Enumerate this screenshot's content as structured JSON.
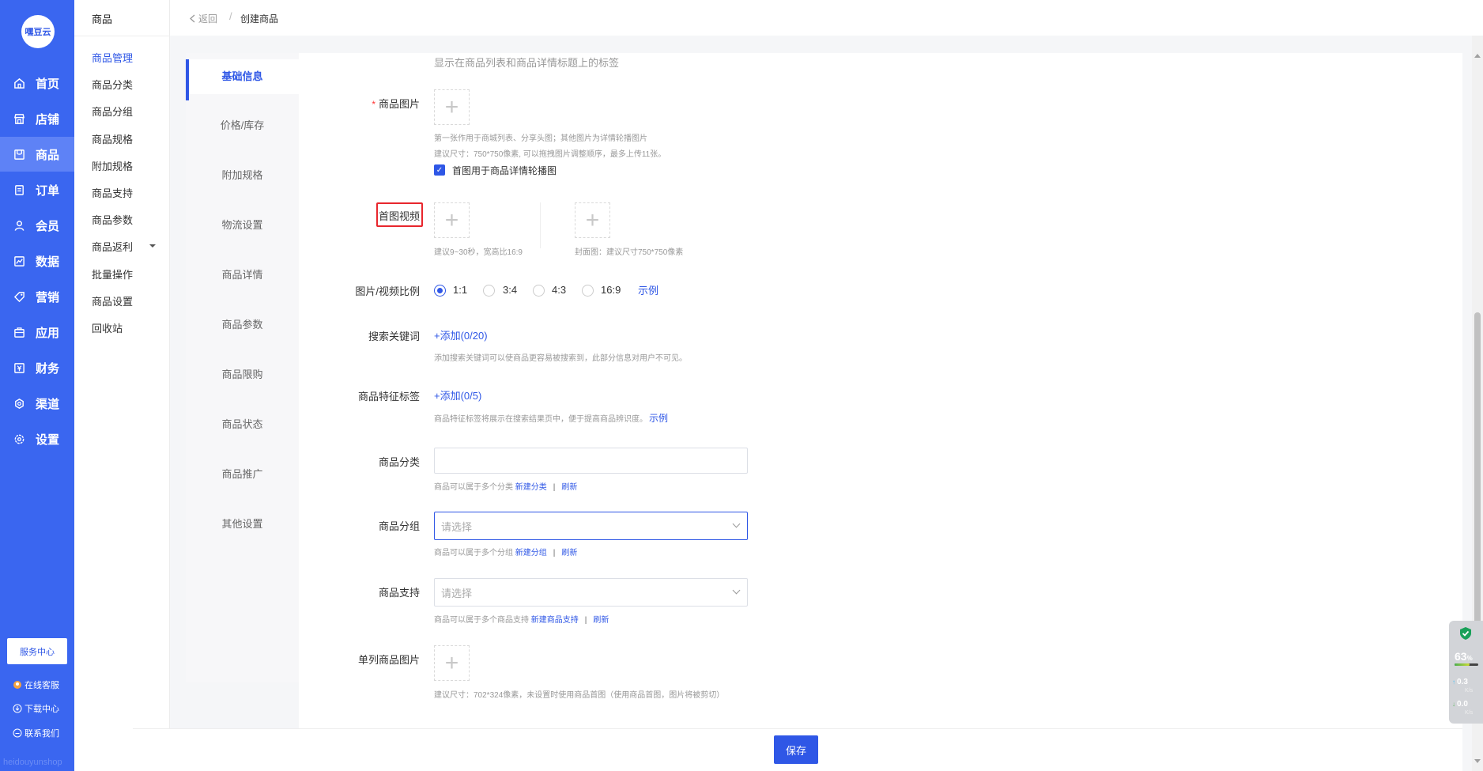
{
  "app": {
    "logo_text": "嘿豆云",
    "watermark": "heidouyunshop"
  },
  "nav": {
    "items": [
      {
        "label": "首页",
        "icon": "home-icon"
      },
      {
        "label": "店铺",
        "icon": "store-icon"
      },
      {
        "label": "商品",
        "icon": "goods-icon",
        "active": true
      },
      {
        "label": "订单",
        "icon": "order-icon"
      },
      {
        "label": "会员",
        "icon": "member-icon"
      },
      {
        "label": "数据",
        "icon": "data-icon"
      },
      {
        "label": "营销",
        "icon": "marketing-icon"
      },
      {
        "label": "应用",
        "icon": "app-icon"
      },
      {
        "label": "财务",
        "icon": "finance-icon"
      },
      {
        "label": "渠道",
        "icon": "channel-icon"
      },
      {
        "label": "设置",
        "icon": "settings-icon"
      }
    ],
    "service_center": "服务中心",
    "links": [
      "在线客服",
      "下载中心",
      "联系我们"
    ]
  },
  "submenu": {
    "title": "商品",
    "items": [
      "商品管理",
      "商品分类",
      "商品分组",
      "商品规格",
      "附加规格",
      "商品支持",
      "商品参数",
      "商品返利",
      "批量操作",
      "商品设置",
      "回收站"
    ]
  },
  "breadcrumb": {
    "back": "返回",
    "separator": "/",
    "current": "创建商品"
  },
  "tabs": [
    "基础信息",
    "价格/库存",
    "附加规格",
    "物流设置",
    "商品详情",
    "商品参数",
    "商品限购",
    "商品状态",
    "商品推广",
    "其他设置"
  ],
  "form": {
    "title_tag_hint": "显示在商品列表和商品详情标题上的标签",
    "images": {
      "label": "商品图片",
      "required_mark": "*",
      "hint1": "第一张作用于商城列表、分享头图；其他图片为详情轮播图片",
      "hint2": "建议尺寸：750*750像素, 可以拖拽图片调整顺序，最多上传11张。",
      "checkbox_label": "首图用于商品详情轮播图"
    },
    "video": {
      "label": "首图视频",
      "hint_video": "建议9~30秒，宽高比16:9",
      "hint_cover": "封面图：建议尺寸750*750像素"
    },
    "ratio": {
      "label": "图片/视频比例",
      "options": [
        "1:1",
        "3:4",
        "4:3",
        "16:9"
      ],
      "selected": "1:1",
      "example_link": "示例"
    },
    "keywords": {
      "label": "搜索关键词",
      "add_link": "+添加(0/20)",
      "hint": "添加搜索关键词可以使商品更容易被搜索到，此部分信息对用户不可见。"
    },
    "feature_tags": {
      "label": "商品特征标签",
      "add_link": "+添加(0/5)",
      "hint": "商品特征标签将展示在搜索结果页中，便于提高商品辨识度。",
      "example_link": "示例"
    },
    "category": {
      "label": "商品分类",
      "value": "",
      "hint": "商品可以属于多个分类",
      "new_link": "新建分类",
      "divider": "|",
      "refresh_link": "刷新"
    },
    "group": {
      "label": "商品分组",
      "placeholder": "请选择",
      "hint": "商品可以属于多个分组",
      "new_link": "新建分组",
      "divider": "|",
      "refresh_link": "刷新"
    },
    "support": {
      "label": "商品支持",
      "placeholder": "请选择",
      "hint": "商品可以属于多个商品支持",
      "new_link": "新建商品支持",
      "divider": "|",
      "refresh_link": "刷新"
    },
    "single_image": {
      "label": "单列商品图片",
      "hint": "建议尺寸：702*324像素，未设置时使用商品首图（使用商品首图，图片将被剪切）"
    },
    "upload_plus": "+"
  },
  "footer": {
    "save_label": "保存"
  },
  "monitor_widget": {
    "percent": "63",
    "percent_unit": "%",
    "usage_fraction": 0.63,
    "upload_speed": "0.3",
    "download_speed": "0.0",
    "speed_unit": "K/s",
    "upload_arrow": "↑",
    "download_arrow": "↓"
  },
  "colors": {
    "primary": "#2f57e6",
    "nav_bg": "#3a66f0",
    "required": "#ff3333",
    "highlight_box": "#e8262d"
  }
}
